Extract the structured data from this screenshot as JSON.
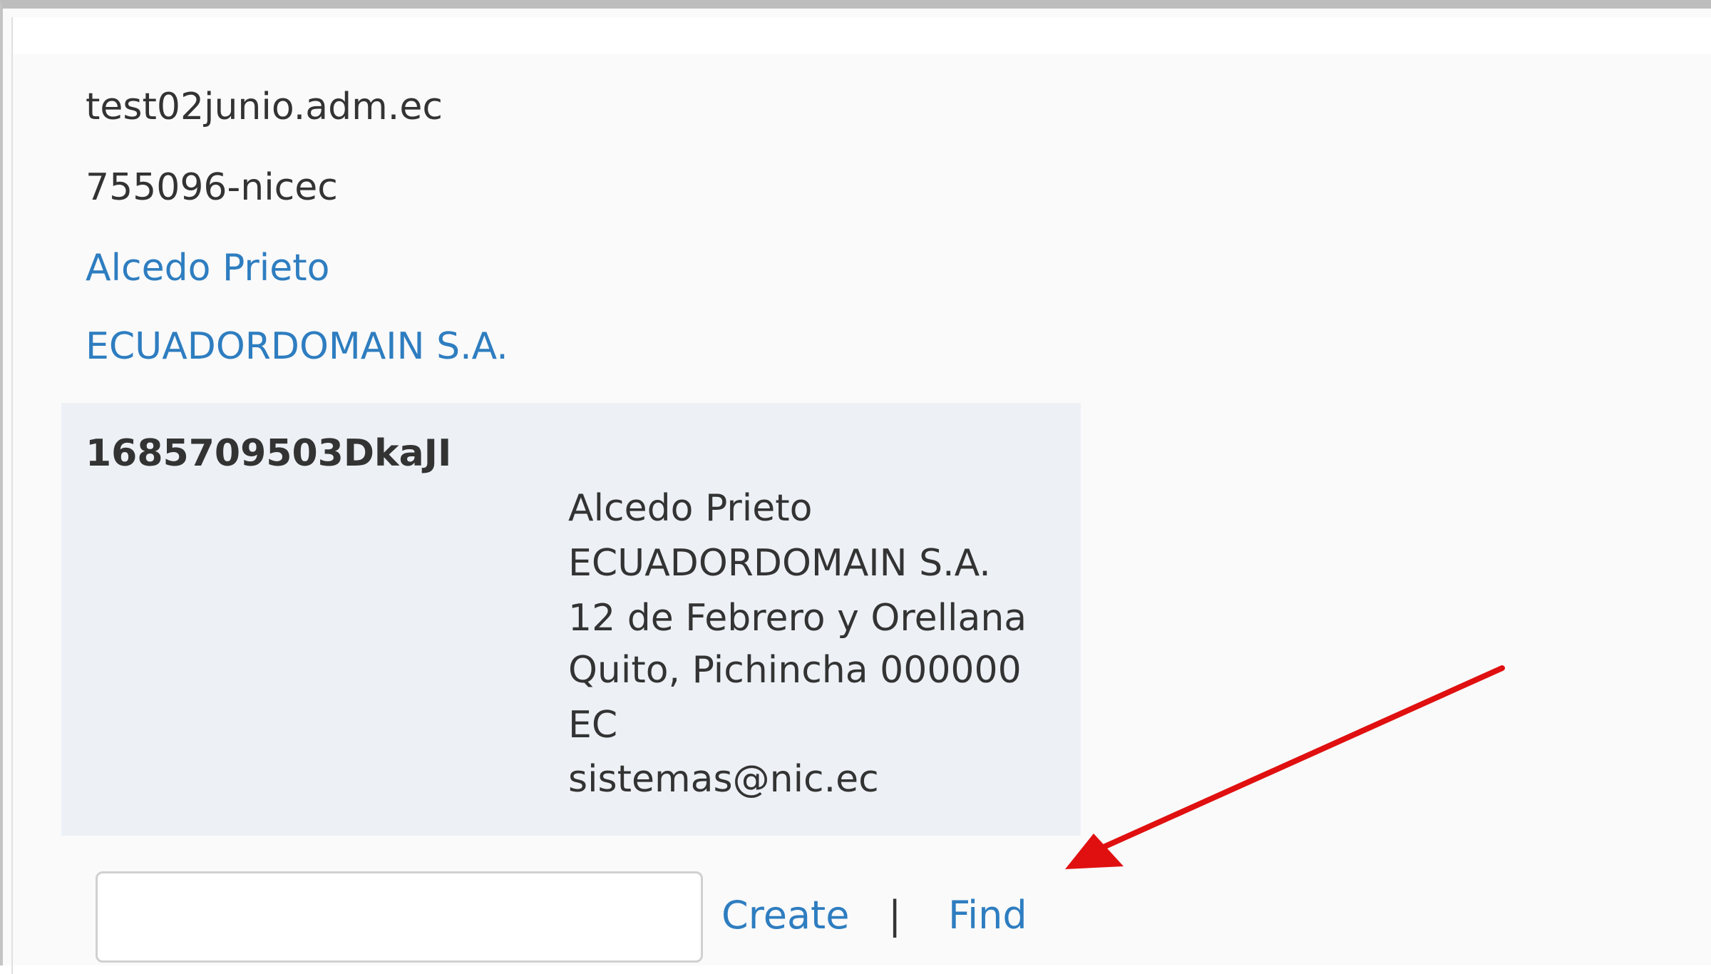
{
  "domain": {
    "name": "test02junio.adm.ec",
    "handle": "755096-nicec",
    "contact_name_link": "Alcedo Prieto",
    "organization_link": "ECUADORDOMAIN S.A."
  },
  "contact_card": {
    "id": "1685709503DkaJI",
    "address_lines": [
      "Alcedo Prieto",
      "ECUADORDOMAIN S.A.",
      "12 de Febrero y Orellana",
      "Quito, Pichincha 000000",
      "EC",
      "sistemas@nic.ec"
    ]
  },
  "actions": {
    "input_value": "",
    "create_label": "Create",
    "separator": "|",
    "find_label": "Find"
  },
  "colors": {
    "link": "#2e7dc0",
    "text": "#333333",
    "card_bg": "#edf1f6",
    "annotation_arrow": "#e01010"
  },
  "annotation": {
    "type": "red-arrow",
    "points_to": "find"
  }
}
